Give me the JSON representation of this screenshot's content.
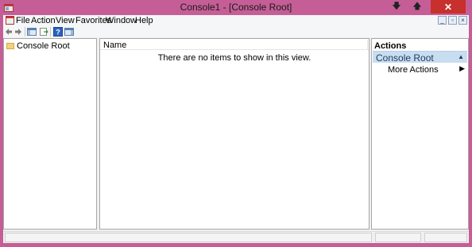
{
  "window": {
    "title": "Console1 - [Console Root]",
    "minimize_glyph": "🡇",
    "maximize_glyph": "🡅",
    "close_glyph": "✕"
  },
  "menu": {
    "items": [
      "File",
      "Action",
      "View",
      "Favorites",
      "Window",
      "Help"
    ],
    "mdi_minimize": "_",
    "mdi_restore": "▫",
    "mdi_close": "×"
  },
  "toolbar": {
    "icons": [
      "back-arrow-icon",
      "forward-arrow-icon",
      "show-hide-tree-icon",
      "export-list-icon",
      "help-icon",
      "show-hide-action-pane-icon"
    ]
  },
  "tree": {
    "root_label": "Console Root"
  },
  "list": {
    "column_name": "Name",
    "empty_message": "There are no items to show in this view."
  },
  "actions": {
    "header": "Actions",
    "section_label": "Console Root",
    "section_arrow": "▲",
    "more_actions": "More Actions",
    "more_arrow": "▶"
  },
  "colors": {
    "frame": "#c55e97",
    "close_button": "#c7302c",
    "section_bg": "#c9ddf1"
  }
}
